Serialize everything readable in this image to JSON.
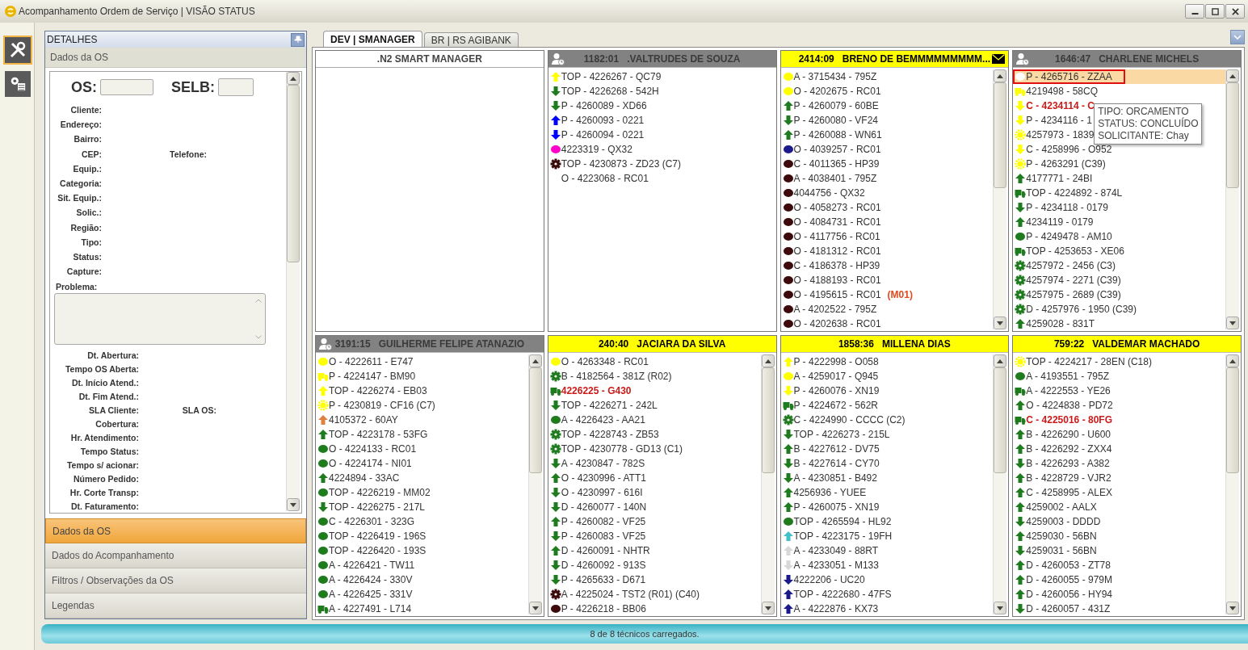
{
  "window": {
    "title": "Acompanhamento Ordem de Serviço | VISÃO STATUS"
  },
  "side_tools": [
    {
      "kind": "tools",
      "selected": true
    },
    {
      "kind": "settings",
      "selected": false
    }
  ],
  "details": {
    "title": "DETALHES",
    "subtitle": "Dados da OS",
    "os_label": "OS:",
    "selb_label": "SELB:",
    "fields_top": [
      {
        "label": "Cliente:"
      },
      {
        "label": "Endereço:"
      },
      {
        "label": "Bairro:"
      },
      {
        "label": "CEP:",
        "extra": "Telefone:"
      },
      {
        "label": "Equip.:"
      },
      {
        "label": "Categoria:"
      },
      {
        "label": "Sit. Equip.:"
      },
      {
        "label": "Solic.:"
      },
      {
        "label": "Região:"
      },
      {
        "label": "Tipo:"
      },
      {
        "label": "Status:"
      },
      {
        "label": "Capture:"
      }
    ],
    "problem_label": "Problema:",
    "fields_bottom": [
      {
        "label": "Dt. Abertura:"
      },
      {
        "label": "Tempo OS Aberta:"
      },
      {
        "label": "Dt. Início Atend.:"
      },
      {
        "label": "Dt. Fim Atend.:"
      },
      {
        "label": "SLA Cliente:",
        "extra": "SLA OS:"
      },
      {
        "label": "Cobertura:"
      },
      {
        "label": "Hr. Atendimento:"
      },
      {
        "label": "Tempo Status:"
      },
      {
        "label": "Tempo s/ acionar:"
      },
      {
        "label": "Número Pedido:"
      },
      {
        "label": "Hr. Corte Transp:"
      },
      {
        "label": "Dt. Faturamento:"
      }
    ],
    "sections": [
      {
        "label": "Dados da OS",
        "selected": true
      },
      {
        "label": "Dados do Acompanhamento",
        "selected": false
      },
      {
        "label": "Filtros / Observações da OS",
        "selected": false
      },
      {
        "label": "Legendas",
        "selected": false
      }
    ]
  },
  "tabs": [
    {
      "label": "DEV | SMANAGER",
      "selected": true
    },
    {
      "label": "BR | RS AGIBANK",
      "selected": false
    }
  ],
  "panels": [
    {
      "kind": "group",
      "title": ".N2 SMART MANAGER"
    },
    {
      "kind": "away",
      "time": "1182:01",
      "name": ".VALTRUDES DE SOUZA",
      "color": "#828282",
      "mail": false,
      "items": [
        {
          "kind": "up",
          "color": "#ffff00",
          "text": "TOP - 4226267 - QC79",
          "alert": false,
          "selected": false
        },
        {
          "kind": "down",
          "color": "#1e7b1e",
          "text": "TOP - 4226268 - 542H",
          "alert": false,
          "selected": false
        },
        {
          "kind": "down",
          "color": "#1e7b1e",
          "text": "P - 4260089 - XD66",
          "alert": false,
          "selected": false
        },
        {
          "kind": "up",
          "color": "#0000ff",
          "text": "P - 4260093 - 0221",
          "alert": false,
          "selected": false
        },
        {
          "kind": "down",
          "color": "#0000ff",
          "text": "P - 4260094 - 0221",
          "alert": false,
          "selected": false
        },
        {
          "kind": "dot",
          "color": "#ff00cc",
          "text": "4223319 - QX32",
          "alert": false,
          "selected": false
        },
        {
          "kind": "gear",
          "color": "#3c0a0a",
          "text": "TOP - 4230873 - ZD23 (C7)",
          "alert": false,
          "selected": false
        },
        {
          "kind": "none",
          "text": "O - 4223068 - RC01",
          "alert": false,
          "selected": false
        }
      ]
    },
    {
      "kind": "active",
      "time": "2414:09",
      "name": "BRENO DE BEMMMMMMMMM...",
      "color": "#ffff00",
      "mail": true,
      "items": [
        {
          "kind": "dot",
          "color": "#ffff00",
          "text": "A - 3715434 - 795Z",
          "alert": false,
          "selected": false
        },
        {
          "kind": "dot",
          "color": "#ffff00",
          "text": "O - 4202675 - RC01",
          "alert": false,
          "selected": false
        },
        {
          "kind": "up",
          "color": "#1e7b1e",
          "text": "P - 4260079 - 60BE",
          "alert": false,
          "selected": false
        },
        {
          "kind": "down",
          "color": "#1e7b1e",
          "text": "P - 4260080 - VF24",
          "alert": false,
          "selected": false
        },
        {
          "kind": "up",
          "color": "#1e7b1e",
          "text": "P - 4260088 - WN61",
          "alert": false,
          "selected": false
        },
        {
          "kind": "dot",
          "color": "#1a1a8c",
          "text": "O - 4039257 - RC01",
          "alert": false,
          "selected": false
        },
        {
          "kind": "dot",
          "color": "#3c0a0a",
          "text": "C - 4011365 - HP39",
          "alert": false,
          "selected": false
        },
        {
          "kind": "dot",
          "color": "#3c0a0a",
          "text": "A - 4038401 - 795Z",
          "alert": false,
          "selected": false
        },
        {
          "kind": "dot",
          "color": "#3c0a0a",
          "text": "4044756 - QX32",
          "alert": false,
          "selected": false
        },
        {
          "kind": "dot",
          "color": "#3c0a0a",
          "text": "O - 4058273 - RC01",
          "alert": false,
          "selected": false
        },
        {
          "kind": "dot",
          "color": "#3c0a0a",
          "text": "O - 4084731 - RC01",
          "alert": false,
          "selected": false
        },
        {
          "kind": "dot",
          "color": "#3c0a0a",
          "text": "O - 4117756 - RC01",
          "alert": false,
          "selected": false
        },
        {
          "kind": "dot",
          "color": "#3c0a0a",
          "text": "O - 4181312 - RC01",
          "alert": false,
          "selected": false
        },
        {
          "kind": "dot",
          "color": "#3c0a0a",
          "text": "C - 4186378 - HP39",
          "alert": false,
          "selected": false
        },
        {
          "kind": "dot",
          "color": "#3c0a0a",
          "text": "O - 4188193 - RC01",
          "alert": false,
          "selected": false
        },
        {
          "kind": "dot",
          "color": "#3c0a0a",
          "text": "O - 4195615 - RC01",
          "tag": "(M01)",
          "alert": false,
          "selected": false
        },
        {
          "kind": "dot",
          "color": "#3c0a0a",
          "text": "A - 4202522 - 795Z",
          "alert": false,
          "selected": false
        },
        {
          "kind": "dot",
          "color": "#3c0a0a",
          "text": "O - 4202638 - RC01",
          "alert": false,
          "selected": false
        }
      ]
    },
    {
      "kind": "away",
      "time": "1646:47",
      "name": "CHARLENE MICHELS",
      "color": "#828282",
      "mail": false,
      "tooltip": [
        "TIPO: ORCAMENTO",
        "STATUS: CONCLUÍDO",
        "SOLICITANTE: Chay"
      ],
      "items": [
        {
          "kind": "dot",
          "color": "#ffffff",
          "text": "P - 4265716 - ZZAA",
          "alert": false,
          "selected": true
        },
        {
          "kind": "truck",
          "color": "#ffff00",
          "text": "4219498 - 58CQ",
          "alert": false,
          "selected": false
        },
        {
          "kind": "down",
          "color": "#ffff00",
          "text": "C - 4234114 - C",
          "alert": true,
          "selected": false
        },
        {
          "kind": "down",
          "color": "#ffff00",
          "text": "P - 4234116 - 1",
          "alert": false,
          "selected": false
        },
        {
          "kind": "sun",
          "color": "#ffff00",
          "text": "4257973 - 1839",
          "alert": false,
          "selected": false
        },
        {
          "kind": "down",
          "color": "#ffff00",
          "text": "C - 4258996 - O952",
          "alert": false,
          "selected": false
        },
        {
          "kind": "sun",
          "color": "#ffff00",
          "text": "P - 4263291 (C39)",
          "alert": false,
          "selected": false
        },
        {
          "kind": "up",
          "color": "#1e7b1e",
          "text": "4177771 - 24BI",
          "alert": false,
          "selected": false
        },
        {
          "kind": "truck",
          "color": "#1e7b1e",
          "text": "TOP - 4224892 - 874L",
          "alert": false,
          "selected": false
        },
        {
          "kind": "down",
          "color": "#1e7b1e",
          "text": "P - 4234118 - 0179",
          "alert": false,
          "selected": false
        },
        {
          "kind": "up",
          "color": "#1e7b1e",
          "text": "4234119 - 0179",
          "alert": false,
          "selected": false
        },
        {
          "kind": "dot",
          "color": "#1e7b1e",
          "text": "P - 4249478 - AM10",
          "alert": false,
          "selected": false
        },
        {
          "kind": "truck",
          "color": "#1e7b1e",
          "text": "TOP - 4253653 - XE06",
          "alert": false,
          "selected": false
        },
        {
          "kind": "gear",
          "color": "#1e7b1e",
          "text": "4257972 - 2456 (C3)",
          "alert": false,
          "selected": false
        },
        {
          "kind": "gear",
          "color": "#1e7b1e",
          "text": "4257974 - 2271 (C39)",
          "alert": false,
          "selected": false
        },
        {
          "kind": "gear",
          "color": "#1e7b1e",
          "text": "4257975 - 2689 (C39)",
          "alert": false,
          "selected": false
        },
        {
          "kind": "gear",
          "color": "#1e7b1e",
          "text": "D - 4257976 - 1950 (C39)",
          "alert": false,
          "selected": false
        },
        {
          "kind": "up",
          "color": "#1e7b1e",
          "text": "4259028 - 831T",
          "alert": false,
          "selected": false
        }
      ]
    },
    {
      "kind": "away",
      "time": "3191:15",
      "name": "GUILHERME FELIPE ATANAZIO",
      "color": "#828282",
      "mail": false,
      "items": [
        {
          "kind": "dot",
          "color": "#ffff00",
          "text": "O - 4222611 - E747",
          "alert": false,
          "selected": false
        },
        {
          "kind": "truck",
          "color": "#ffff00",
          "text": "P - 4224147 - BM90",
          "alert": false,
          "selected": false
        },
        {
          "kind": "up",
          "color": "#ffff00",
          "text": "TOP - 4226274 - EB03",
          "alert": false,
          "selected": false
        },
        {
          "kind": "sun",
          "color": "#ffff00",
          "text": "P - 4230819 - CF16 (C7)",
          "alert": false,
          "selected": false
        },
        {
          "kind": "up",
          "color": "#e08040",
          "text": "4105372 - 60AY",
          "alert": false,
          "selected": false
        },
        {
          "kind": "up",
          "color": "#1e7b1e",
          "text": "TOP - 4223178 - 53FG",
          "alert": false,
          "selected": false
        },
        {
          "kind": "dot",
          "color": "#1e7b1e",
          "text": "O - 4224133 - RC01",
          "alert": false,
          "selected": false
        },
        {
          "kind": "dot",
          "color": "#1e7b1e",
          "text": "O - 4224174 - NI01",
          "alert": false,
          "selected": false
        },
        {
          "kind": "up",
          "color": "#1e7b1e",
          "text": "4224894 - 33AC",
          "alert": false,
          "selected": false
        },
        {
          "kind": "dot",
          "color": "#1e7b1e",
          "text": "TOP - 4226219 - MM02",
          "alert": false,
          "selected": false
        },
        {
          "kind": "down",
          "color": "#1e7b1e",
          "text": "TOP - 4226275 - 217L",
          "alert": false,
          "selected": false
        },
        {
          "kind": "dot",
          "color": "#1e7b1e",
          "text": "C - 4226301 - 323G",
          "alert": false,
          "selected": false
        },
        {
          "kind": "dot",
          "color": "#1e7b1e",
          "text": "TOP - 4226419 - 196S",
          "alert": false,
          "selected": false
        },
        {
          "kind": "dot",
          "color": "#1e7b1e",
          "text": "TOP - 4226420 - 193S",
          "alert": false,
          "selected": false
        },
        {
          "kind": "dot",
          "color": "#1e7b1e",
          "text": "A - 4226421 - TW11",
          "alert": false,
          "selected": false
        },
        {
          "kind": "dot",
          "color": "#1e7b1e",
          "text": "A - 4226424 - 330V",
          "alert": false,
          "selected": false
        },
        {
          "kind": "dot",
          "color": "#1e7b1e",
          "text": "A - 4226425 - 331V",
          "alert": false,
          "selected": false
        },
        {
          "kind": "truck",
          "color": "#1e7b1e",
          "text": "A - 4227491 - L714",
          "alert": false,
          "selected": false
        }
      ]
    },
    {
      "kind": "active",
      "time": "240:40",
      "name": "JACIARA DA SILVA",
      "color": "#ffff00",
      "mail": false,
      "items": [
        {
          "kind": "dot",
          "color": "#ffff00",
          "text": "O - 4263348 - RC01",
          "alert": false,
          "selected": false
        },
        {
          "kind": "gear",
          "color": "#1e7b1e",
          "text": "B - 4182564 - 381Z (R02)",
          "alert": false,
          "selected": false
        },
        {
          "kind": "truck",
          "color": "#1e7b1e",
          "text": "4226225 - G430",
          "alert": true,
          "selected": false
        },
        {
          "kind": "down",
          "color": "#1e7b1e",
          "text": "TOP - 4226271 - 242L",
          "alert": false,
          "selected": false
        },
        {
          "kind": "dot",
          "color": "#1e7b1e",
          "text": "A - 4226423 - AA21",
          "alert": false,
          "selected": false
        },
        {
          "kind": "gear",
          "color": "#1e7b1e",
          "text": "TOP - 4228743 - ZB53",
          "alert": false,
          "selected": false
        },
        {
          "kind": "gear",
          "color": "#1e7b1e",
          "text": "TOP - 4230778 - GD13 (C1)",
          "alert": false,
          "selected": false
        },
        {
          "kind": "down",
          "color": "#1e7b1e",
          "text": "A - 4230847 - 782S",
          "alert": false,
          "selected": false
        },
        {
          "kind": "up",
          "color": "#1e7b1e",
          "text": "O - 4230996 - ATT1",
          "alert": false,
          "selected": false
        },
        {
          "kind": "down",
          "color": "#1e7b1e",
          "text": "O - 4230997 - 616I",
          "alert": false,
          "selected": false
        },
        {
          "kind": "down",
          "color": "#1e7b1e",
          "text": "D - 4260077 - 140N",
          "alert": false,
          "selected": false
        },
        {
          "kind": "up",
          "color": "#1e7b1e",
          "text": "P - 4260082 - VF25",
          "alert": false,
          "selected": false
        },
        {
          "kind": "down",
          "color": "#1e7b1e",
          "text": "P - 4260083 - VF25",
          "alert": false,
          "selected": false
        },
        {
          "kind": "up",
          "color": "#1e7b1e",
          "text": "D - 4260091 - NHTR",
          "alert": false,
          "selected": false
        },
        {
          "kind": "down",
          "color": "#1e7b1e",
          "text": "D - 4260092 - 913S",
          "alert": false,
          "selected": false
        },
        {
          "kind": "down",
          "color": "#1e7b1e",
          "text": "P - 4265633 - D671",
          "alert": false,
          "selected": false
        },
        {
          "kind": "gear",
          "color": "#3c0a0a",
          "text": "A - 4225024 - TST2 (R01) (C40)",
          "alert": false,
          "selected": false
        },
        {
          "kind": "dot",
          "color": "#3c0a0a",
          "text": "P - 4226218 - BB06",
          "alert": false,
          "selected": false
        }
      ]
    },
    {
      "kind": "active",
      "time": "1858:36",
      "name": "MILLENA DIAS",
      "color": "#ffff00",
      "mail": false,
      "items": [
        {
          "kind": "up",
          "color": "#ffff00",
          "text": "P - 4222998 - O058",
          "alert": false,
          "selected": false
        },
        {
          "kind": "dot",
          "color": "#ffff00",
          "text": "A - 4259017 - Q945",
          "alert": false,
          "selected": false
        },
        {
          "kind": "down",
          "color": "#ffff00",
          "text": "P - 4260076 - XN19",
          "alert": false,
          "selected": false
        },
        {
          "kind": "truck",
          "color": "#1e7b1e",
          "text": "P - 4224672 - 562R",
          "alert": false,
          "selected": false
        },
        {
          "kind": "gear",
          "color": "#1e7b1e",
          "text": "C - 4224990 - CCCC (C2)",
          "alert": false,
          "selected": false
        },
        {
          "kind": "down",
          "color": "#1e7b1e",
          "text": "TOP - 4226273 - 215L",
          "alert": false,
          "selected": false
        },
        {
          "kind": "up",
          "color": "#1e7b1e",
          "text": "B - 4227612 - DV75",
          "alert": false,
          "selected": false
        },
        {
          "kind": "down",
          "color": "#1e7b1e",
          "text": "B - 4227614 - CY70",
          "alert": false,
          "selected": false
        },
        {
          "kind": "down",
          "color": "#1e7b1e",
          "text": "A - 4230851 - B492",
          "alert": false,
          "selected": false
        },
        {
          "kind": "up",
          "color": "#1e7b1e",
          "text": "4256936 - YUEE",
          "alert": false,
          "selected": false
        },
        {
          "kind": "up",
          "color": "#1e7b1e",
          "text": "P - 4260075 - XN19",
          "alert": false,
          "selected": false
        },
        {
          "kind": "dot",
          "color": "#1e7b1e",
          "text": "TOP - 4265594 - HL92",
          "alert": false,
          "selected": false
        },
        {
          "kind": "up",
          "color": "#40c0c8",
          "text": "TOP - 4223175 - 19FH",
          "alert": false,
          "selected": false
        },
        {
          "kind": "up",
          "color": "#d8d8d8",
          "text": "A - 4233049 - 88RT",
          "alert": false,
          "selected": false
        },
        {
          "kind": "down",
          "color": "#d8d8d8",
          "text": "A - 4233051 - M133",
          "alert": false,
          "selected": false
        },
        {
          "kind": "down",
          "color": "#1a1a8c",
          "text": "4222206 - UC20",
          "alert": false,
          "selected": false
        },
        {
          "kind": "up",
          "color": "#1a1a8c",
          "text": "TOP - 4222680 - 47FS",
          "alert": false,
          "selected": false
        },
        {
          "kind": "up",
          "color": "#1a1a8c",
          "text": "A - 4222876 - KX73",
          "alert": false,
          "selected": false
        }
      ]
    },
    {
      "kind": "active",
      "time": "759:22",
      "name": "VALDEMAR MACHADO",
      "color": "#ffff00",
      "mail": false,
      "items": [
        {
          "kind": "sun",
          "color": "#ffff00",
          "text": "TOP - 4224217 - 28EN (C18)",
          "alert": false,
          "selected": false
        },
        {
          "kind": "dot",
          "color": "#1e7b1e",
          "text": "A - 4193551 - 795Z",
          "alert": false,
          "selected": false
        },
        {
          "kind": "truck",
          "color": "#1e7b1e",
          "text": "A - 4222553 - YE26",
          "alert": false,
          "selected": false
        },
        {
          "kind": "up",
          "color": "#1e7b1e",
          "text": "O - 4224838 - PD72",
          "alert": false,
          "selected": false
        },
        {
          "kind": "truck",
          "color": "#1e7b1e",
          "text": "C - 4225016 - 80FG",
          "alert": true,
          "selected": false
        },
        {
          "kind": "up",
          "color": "#1e7b1e",
          "text": "B - 4226290 - U600",
          "alert": false,
          "selected": false
        },
        {
          "kind": "up",
          "color": "#1e7b1e",
          "text": "B - 4226292 - ZXX4",
          "alert": false,
          "selected": false
        },
        {
          "kind": "down",
          "color": "#1e7b1e",
          "text": "B - 4226293 - A382",
          "alert": false,
          "selected": false
        },
        {
          "kind": "up",
          "color": "#1e7b1e",
          "text": "B - 4228729 - VJR2",
          "alert": false,
          "selected": false
        },
        {
          "kind": "up",
          "color": "#1e7b1e",
          "text": "C - 4258995 - ALEX",
          "alert": false,
          "selected": false
        },
        {
          "kind": "up",
          "color": "#1e7b1e",
          "text": "4259002 - AALX",
          "alert": false,
          "selected": false
        },
        {
          "kind": "down",
          "color": "#1e7b1e",
          "text": "4259003 - DDDD",
          "alert": false,
          "selected": false
        },
        {
          "kind": "up",
          "color": "#1e7b1e",
          "text": "4259030 - 56BN",
          "alert": false,
          "selected": false
        },
        {
          "kind": "down",
          "color": "#1e7b1e",
          "text": "4259031 - 56BN",
          "alert": false,
          "selected": false
        },
        {
          "kind": "up",
          "color": "#1e7b1e",
          "text": "D - 4260053 - ZT78",
          "alert": false,
          "selected": false
        },
        {
          "kind": "up",
          "color": "#1e7b1e",
          "text": "D - 4260055 - 979M",
          "alert": false,
          "selected": false
        },
        {
          "kind": "up",
          "color": "#1e7b1e",
          "text": "D - 4260056 - HY94",
          "alert": false,
          "selected": false
        },
        {
          "kind": "down",
          "color": "#1e7b1e",
          "text": "D - 4260057 - 431Z",
          "alert": false,
          "selected": false
        }
      ]
    }
  ],
  "status_bar": {
    "text": "8 de 8 técnicos carregados."
  }
}
